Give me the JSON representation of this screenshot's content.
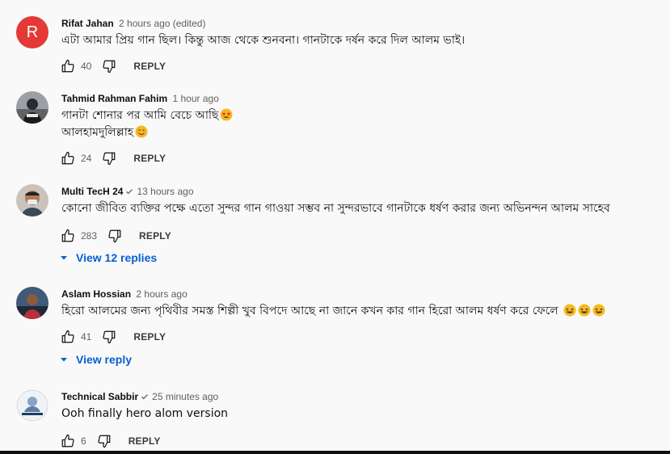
{
  "colors": {
    "background": "#f9f9f9",
    "text": "#0f0f0f",
    "secondary": "#606060",
    "link": "#065fd4",
    "avatar_r": "#e53935"
  },
  "comments": [
    {
      "author": "Rifat Jahan",
      "time": "2 hours ago (edited)",
      "avatar_letter": "R",
      "lines": [
        "এটা আমার প্রিয় গান ছিল। কিন্তু আজ থেকে  শুনবনা। গানটাকে দর্ষন করে দিল আলম ভাই।"
      ],
      "likes": "40",
      "reply": "REPLY"
    },
    {
      "author": "Tahmid Rahman Fahim",
      "time": "1 hour ago",
      "lines": [
        "গানটা শোনার পর আমি বেচে আছি",
        "আলহামদুলিল্লাহ"
      ],
      "line_emojis": [
        "star-struck-emoji",
        "smiling-emoji"
      ],
      "likes": "24",
      "reply": "REPLY"
    },
    {
      "author": "Multi TecH 24",
      "verified": true,
      "time": "13 hours ago",
      "lines": [
        "কোনো জীবিত ব্যক্তির পক্ষে এতো সুন্দর গান গাওয়া সম্ভব না সুন্দরভাবে গানটাকে ধর্ষণ করার জন্য অভিনন্দন আলম সাহেব"
      ],
      "likes": "283",
      "reply": "REPLY",
      "view_replies": "View 12 replies"
    },
    {
      "author": "Aslam Hossian",
      "time": "2 hours ago",
      "lines": [
        "হিরো আলমের জন্য পৃথিবীর সমস্ত শিল্পী খুব বিপদে আছে না জানে কখন কার গান হিরো আলম ধর্ষণ করে ফেলে"
      ],
      "line_emojis": [
        "laughing-emoji"
      ],
      "emoji_repeat": 3,
      "likes": "41",
      "reply": "REPLY",
      "view_replies": "View reply"
    },
    {
      "author": "Technical Sabbir",
      "verified": true,
      "time": "25 minutes ago",
      "lines": [
        "Ooh finally hero alom version"
      ],
      "likes": "6",
      "reply": "REPLY"
    }
  ]
}
